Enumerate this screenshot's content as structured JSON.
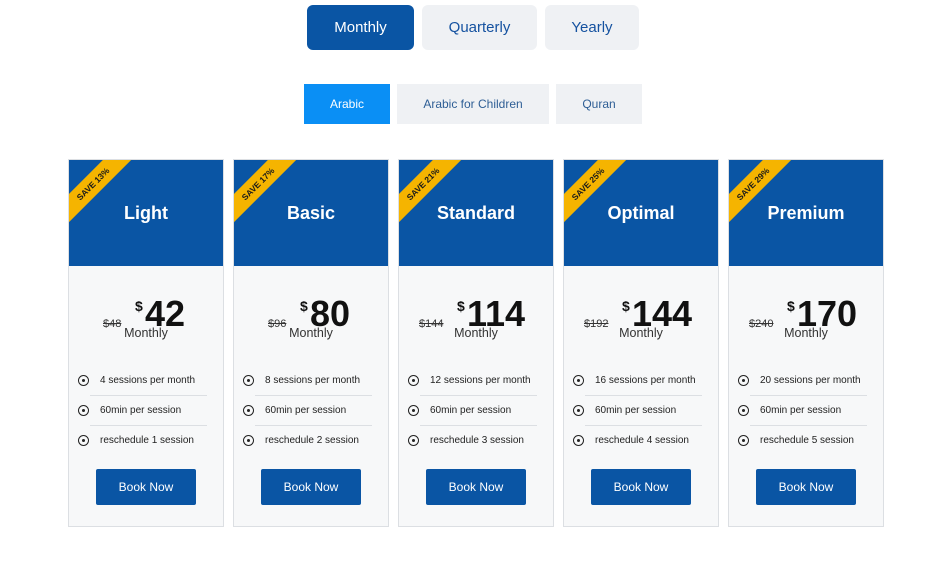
{
  "period_tabs": [
    {
      "label": "Monthly",
      "active": true
    },
    {
      "label": "Quarterly",
      "active": false
    },
    {
      "label": "Yearly",
      "active": false
    }
  ],
  "course_tabs": [
    {
      "label": "Arabic",
      "active": true
    },
    {
      "label": "Arabic for Children",
      "active": false
    },
    {
      "label": "Quran",
      "active": false
    }
  ],
  "currency_symbol": "$",
  "book_label": "Book Now",
  "plans": [
    {
      "name": "Light",
      "ribbon": "SAVE 13%",
      "old_price": "$48",
      "price": "42",
      "period": "Monthly",
      "features": [
        "4 sessions per month",
        "60min per session",
        "reschedule 1 session"
      ]
    },
    {
      "name": "Basic",
      "ribbon": "SAVE 17%",
      "old_price": "$96",
      "price": "80",
      "period": "Monthly",
      "features": [
        "8 sessions per month",
        "60min per session",
        "reschedule 2 session"
      ]
    },
    {
      "name": "Standard",
      "ribbon": "SAVE 21%",
      "old_price": "$144",
      "price": "114",
      "period": "Monthly",
      "features": [
        "12 sessions per month",
        "60min per session",
        "reschedule 3 session"
      ]
    },
    {
      "name": "Optimal",
      "ribbon": "SAVE 25%",
      "old_price": "$192",
      "price": "144",
      "period": "Monthly",
      "features": [
        "16 sessions per month",
        "60min per session",
        "reschedule 4 session"
      ]
    },
    {
      "name": "Premium",
      "ribbon": "SAVE 29%",
      "old_price": "$240",
      "price": "170",
      "period": "Monthly",
      "features": [
        "20 sessions per month",
        "60min per session",
        "reschedule 5 session"
      ]
    }
  ]
}
